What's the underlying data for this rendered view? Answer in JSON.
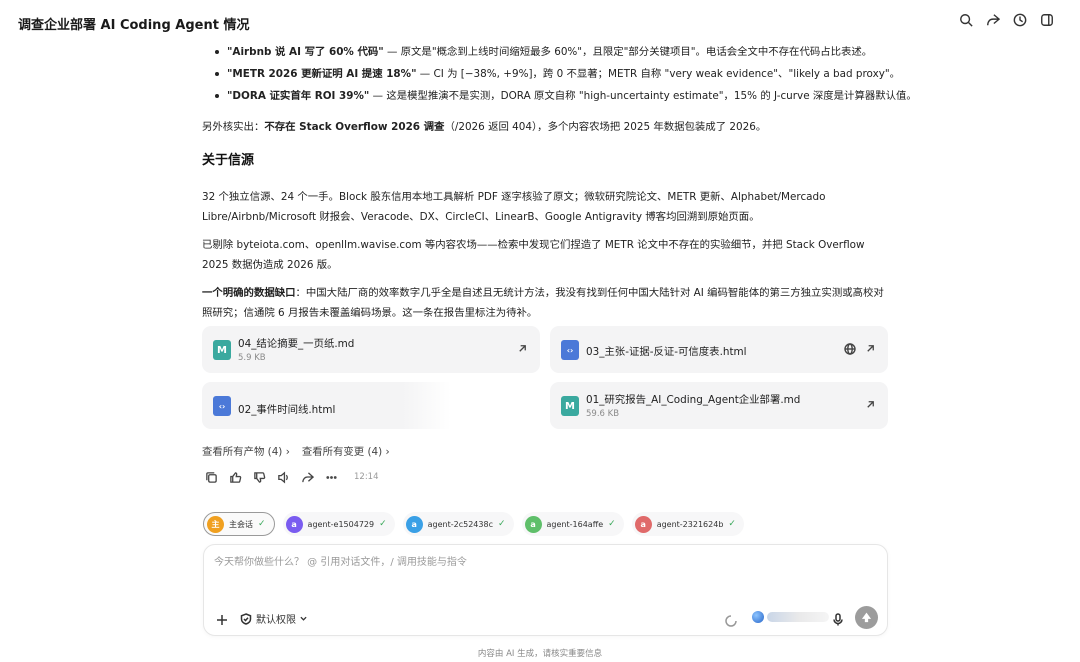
{
  "header": {
    "title": "调查企业部署 AI Coding Agent 情况"
  },
  "message": {
    "bullets": [
      {
        "bold": "\"Airbnb 说 AI 写了 60% 代码\"",
        "text": " — 原文是\"概念到上线时间缩短最多 60%\"，且限定\"部分关键项目\"。电话会全文中不存在代码占比表述。"
      },
      {
        "bold": "\"METR 2026 更新证明 AI 提速 18%\"",
        "text": " — CI 为 [−38%, +9%]，跨 0 不显著；METR 自称 \"very weak evidence\"、\"likely a bad proxy\"。"
      },
      {
        "bold": "\"DORA 证实首年 ROI 39%\"",
        "text": " — 这是模型推演不是实测，DORA 原文自称 \"high-uncertainty estimate\"，15% 的 J-curve 深度是计算器默认值。"
      }
    ],
    "also_prefix": "另外核实出：",
    "also_bold": "不存在 Stack Overflow 2026 调查",
    "also_text": "（/2026 返回 404），多个内容农场把 2025 年数据包装成了 2026。",
    "section_title": "关于信源",
    "p_sources": "32 个独立信源、24 个一手。Block 股东信用本地工具解析 PDF 逐字核验了原文；微软研究院论文、METR 更新、Alphabet/Mercado Libre/Airbnb/Microsoft 财报会、Veracode、DX、CircleCI、LinearB、Google Antigravity 博客均回溯到原始页面。",
    "p_removed": "已剔除 byteiota.com、openllm.wavise.com 等内容农场——检索中发现它们捏造了 METR 论文中不存在的实验细节，并把 Stack Overflow 2025 数据伪造成 2026 版。",
    "gap_bold": "一个明确的数据缺口",
    "gap_text": "：中国大陆厂商的效率数字几乎全是自述且无统计方法，我没有找到任何中国大陆针对 AI 编码智能体的第三方独立实测或高校对照研究；信通院 6 月报告未覆盖编码场景。这一条在报告里标注为待补。"
  },
  "files": [
    {
      "name": "04_结论摘要_一页纸.md",
      "size": "5.9 KB",
      "type": "md",
      "glyph": "M"
    },
    {
      "name": "03_主张-证据-反证-可信度表.html",
      "size": "",
      "type": "html",
      "glyph": "‹›"
    },
    {
      "name": "02_事件时间线.html",
      "size": "",
      "type": "html",
      "glyph": "‹›"
    },
    {
      "name": "01_研究报告_AI_Coding_Agent企业部署.md",
      "size": "59.6 KB",
      "type": "md",
      "glyph": "M"
    }
  ],
  "links": {
    "artifacts": "查看所有产物 (4)",
    "changes": "查看所有变更 (4)"
  },
  "actions": {
    "time": "12:14"
  },
  "chips": [
    {
      "label": "主会话",
      "avatar": "主",
      "color": "#f0a020"
    },
    {
      "label": "agent-e1504729",
      "avatar": "a",
      "color": "#7a5cf0"
    },
    {
      "label": "agent-2c52438c",
      "avatar": "a",
      "color": "#3aa0e6"
    },
    {
      "label": "agent-164affe",
      "avatar": "a",
      "color": "#5fbf6a"
    },
    {
      "label": "agent-2321624b",
      "avatar": "a",
      "color": "#e06a6a"
    }
  ],
  "input": {
    "placeholder": "今天帮你做些什么？ @ 引用对话文件，/ 调用技能与指令",
    "permission": "默认权限"
  },
  "footer": {
    "notice": "内容由 AI 生成，请核实重要信息"
  }
}
